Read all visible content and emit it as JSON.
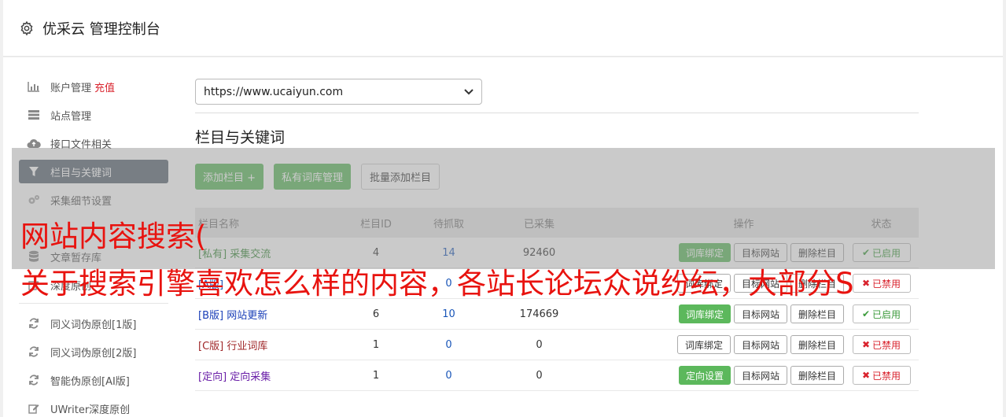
{
  "header": {
    "title": "优采云 管理控制台",
    "icon": "gear-icon"
  },
  "sidebar": {
    "items": [
      {
        "label": "账户管理",
        "extra": "充值",
        "icon": "bar-chart-icon"
      },
      {
        "label": "站点管理",
        "icon": "server-icon"
      },
      {
        "label": "接口文件相关",
        "icon": "cloud-upload-icon"
      },
      {
        "label": "栏目与关键词",
        "icon": "filter-icon",
        "active": true
      },
      {
        "label": "采集细节设置",
        "icon": "cogs-icon"
      },
      {
        "label": "",
        "icon": "list-icon"
      },
      {
        "label": "文章暂存库",
        "icon": "database-icon"
      },
      {
        "label": "深度原创",
        "icon": "edit-icon"
      }
    ],
    "items2": [
      {
        "label": "同义词伪原创[1版]",
        "icon": "refresh-icon"
      },
      {
        "label": "同义词伪原创[2版]",
        "icon": "refresh-icon"
      },
      {
        "label": "智能伪原创[AI版]",
        "icon": "refresh-icon"
      },
      {
        "label": "UWriter深度原创",
        "icon": "edit-icon"
      }
    ]
  },
  "main": {
    "site_select": "https://www.ucaiyun.com",
    "section_title": "栏目与关键词",
    "buttons": {
      "add": "添加栏目 +",
      "private": "私有词库管理",
      "batch": "批量添加栏目"
    },
    "table": {
      "headers": {
        "name": "栏目名称",
        "id": "栏目ID",
        "wait": "待抓取",
        "done": "已采集",
        "ops": "操作",
        "status": "状态"
      },
      "rows": [
        {
          "tag": "[私有]",
          "name": "采集交流",
          "id": "4",
          "wait": "14",
          "done": "92460",
          "op1": "词库绑定",
          "op2": "目标网站",
          "op3": "删除栏目",
          "status": "已启用",
          "on": true,
          "color": "#3a8a3a"
        },
        {
          "tag": "[A版]",
          "name": "",
          "id": "",
          "wait": "0",
          "done": "",
          "op1": "词库绑定",
          "op2": "目标网站",
          "op3": "删除栏目",
          "status": "已禁用",
          "on": false,
          "color": "#1a56b8"
        },
        {
          "tag": "[B版]",
          "name": "网站更新",
          "id": "6",
          "wait": "10",
          "done": "174669",
          "op1": "词库绑定",
          "op2": "目标网站",
          "op3": "删除栏目",
          "status": "已启用",
          "on": true,
          "color": "#1a3fb8"
        },
        {
          "tag": "[C版]",
          "name": "行业词库",
          "id": "1",
          "wait": "0",
          "done": "0",
          "op1": "词库绑定",
          "op2": "目标网站",
          "op3": "删除栏目",
          "status": "已禁用",
          "on": false,
          "color": "#a0282a"
        },
        {
          "tag": "[定向]",
          "name": "定向采集",
          "id": "1",
          "wait": "0",
          "done": "0",
          "op1": "定向设置",
          "op2": "目标网站",
          "op3": "删除栏目",
          "status": "已禁用",
          "on": false,
          "color": "#6a1fa8"
        }
      ]
    }
  },
  "overlay": {
    "line1": "网站内容搜索(",
    "line2": "关于搜索引擎喜欢怎么样的内容，各站长论坛众说纷纭，大部分S"
  }
}
